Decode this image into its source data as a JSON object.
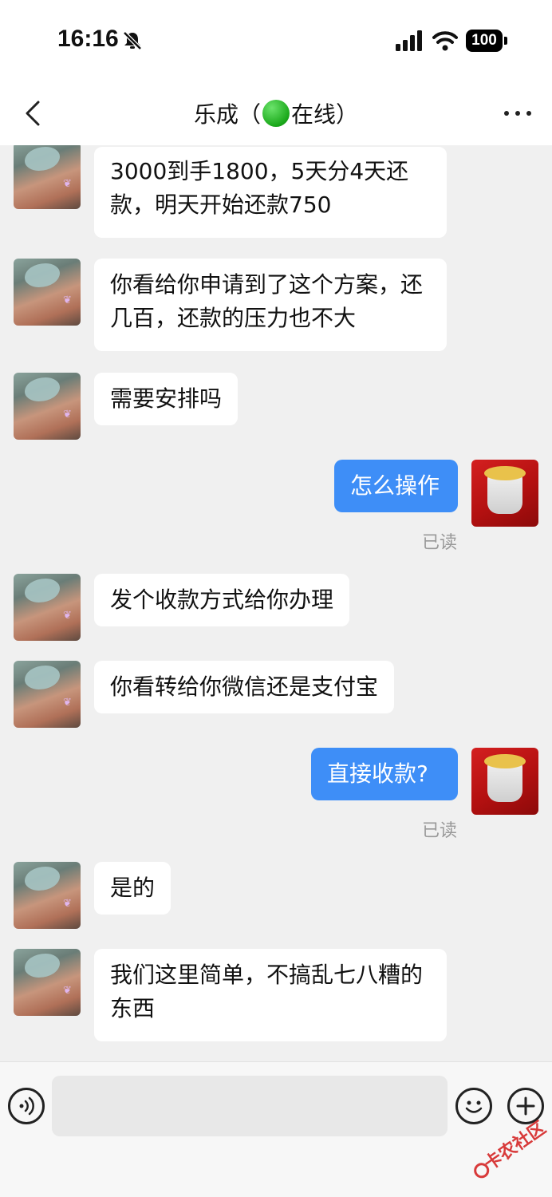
{
  "status_bar": {
    "time": "16:16",
    "battery": "100"
  },
  "nav": {
    "title_name": "乐成（",
    "title_status": "在线）"
  },
  "messages": [
    {
      "side": "in",
      "text": "3000到手1800，5天分4天还款，明天开始还款750"
    },
    {
      "side": "in",
      "text": "你看给你申请到了这个方案，还几百，还款的压力也不大"
    },
    {
      "side": "in",
      "text": "需要安排吗"
    },
    {
      "side": "out",
      "text": "怎么操作",
      "status": "已读"
    },
    {
      "side": "in",
      "text": "发个收款方式给你办理"
    },
    {
      "side": "in",
      "text": "你看转给你微信还是支付宝"
    },
    {
      "side": "out",
      "text": "直接收款?",
      "status": "已读"
    },
    {
      "side": "in",
      "text": "是的"
    },
    {
      "side": "in",
      "text": "我们这里简单，不搞乱七八糟的东西"
    }
  ],
  "watermark": "卡农社区",
  "colors": {
    "out_bubble": "#3e8ef7",
    "in_bubble": "#ffffff",
    "background": "#f0f0f0",
    "online": "#1aa81a"
  }
}
